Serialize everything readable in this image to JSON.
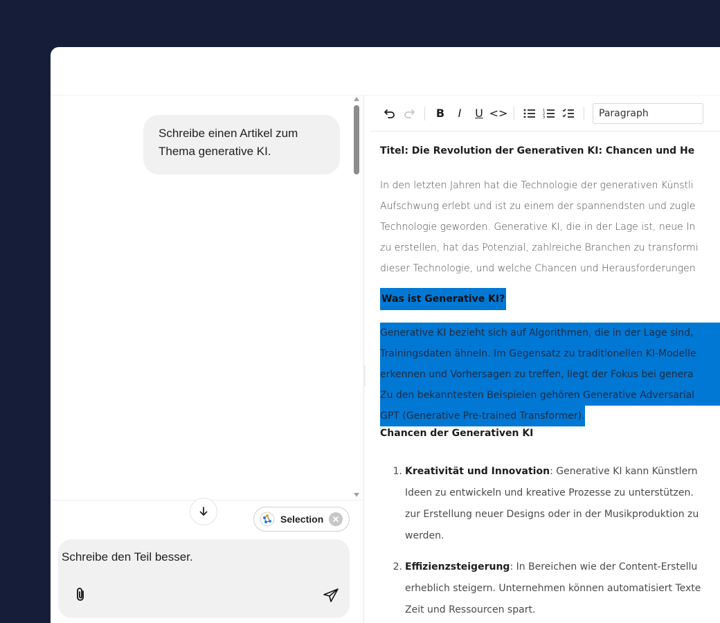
{
  "window": {
    "ghost_tab": "· · ·"
  },
  "chat": {
    "user_message_line1": "Schreibe einen Artikel zum",
    "user_message_line2": "Thema generative KI.",
    "selection_chip": "Selection",
    "composer_value": "Schreibe den Teil besser."
  },
  "editor": {
    "toolbar": {
      "undo": "↶",
      "redo": "↷",
      "bold": "B",
      "italic": "I",
      "underline": "U",
      "code": "<>",
      "block_type": "Paragraph"
    },
    "title": "Titel: Die Revolution der Generativen KI: Chancen und He",
    "intro_lines": [
      "In den letzten Jahren hat die Technologie der generativen Künstli",
      "Aufschwung erlebt und ist zu einem der spannendsten und zugle",
      "Technologie geworden. Generative KI, die in der Lage ist, neue In",
      "zu erstellen, hat das Potenzial, zahlreiche Branchen zu transformi",
      "dieser Technologie, und welche Chancen und Herausforderungen"
    ],
    "selected_heading": "Was ist Generative KI?",
    "selected_lines": [
      "Generative KI bezieht sich auf Algorithmen, die in der Lage sind,",
      "Trainingsdaten ähneln. Im Gegensatz zu traditionellen KI-Modelle",
      "erkennen und Vorhersagen zu treffen, liegt der Fokus bei genera",
      "Zu den bekanntesten Beispielen gehören Generative Adversarial",
      "GPT (Generative Pre-trained Transformer)."
    ],
    "section_heading": "Chancen der Generativen KI",
    "list": [
      {
        "num": "1.",
        "bold": "Kreativität und Innovation",
        "rest": ": Generative KI kann Künstlern",
        "more": [
          "Ideen zu entwickeln und kreative Prozesse zu unterstützen.",
          "zur Erstellung neuer Designs oder in der Musikproduktion zu",
          "werden."
        ]
      },
      {
        "num": "2.",
        "bold": "Effizienzsteigerung",
        "rest": ": In Bereichen wie der Content-Erstellu",
        "more": [
          "erheblich steigern. Unternehmen können automatisiert Texte",
          "Zeit und Ressourcen spart."
        ]
      }
    ]
  },
  "colors": {
    "background": "#161d39",
    "selection": "#0078d4",
    "bubble": "#f1f1f1"
  }
}
